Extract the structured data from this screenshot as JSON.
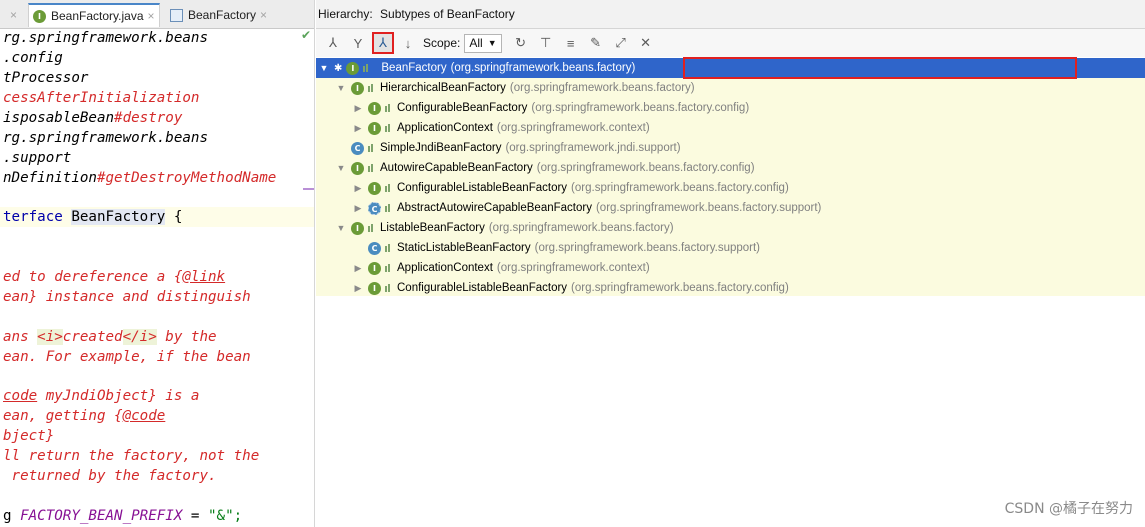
{
  "editor": {
    "tabs": [
      {
        "label": "BeanFactory.java",
        "close": "×"
      },
      {
        "label": "BeanFactory",
        "close": "×"
      }
    ],
    "left_close": "×",
    "lines": [
      "rg.springframework.beans",
      ".config",
      "tProcessor",
      "cessAfterInitialization",
      "isposableBean",
      "#destroy",
      "rg.springframework.beans",
      ".support",
      "nDefinition",
      "#getDestroyMethodName",
      "terface ",
      "BeanFactory",
      " {",
      "ed to dereference a {",
      "@link",
      "ean} instance and distinguish",
      "ans ",
      "<i>",
      "created",
      "</i>",
      " by the",
      "ean. For example, if the bean",
      "code",
      " myJndiObject} is a",
      "ean, getting {",
      "@code",
      "bject}",
      "ll return the factory, not the",
      " returned by the factory.",
      "g ",
      "FACTORY_BEAN_PREFIX",
      " = ",
      "\"&\";"
    ]
  },
  "hierarchy": {
    "title": "Hierarchy:",
    "subtitle": "Subtypes of BeanFactory",
    "toolbar": {
      "scope_label": "Scope:",
      "scope_value": "All"
    },
    "nodes": [
      {
        "name": "BeanFactory",
        "pkg": "(org.springframework.beans.factory)"
      },
      {
        "name": "HierarchicalBeanFactory",
        "pkg": "(org.springframework.beans.factory)"
      },
      {
        "name": "ConfigurableBeanFactory",
        "pkg": "(org.springframework.beans.factory.config)"
      },
      {
        "name": "ApplicationContext",
        "pkg": "(org.springframework.context)"
      },
      {
        "name": "SimpleJndiBeanFactory",
        "pkg": "(org.springframework.jndi.support)"
      },
      {
        "name": "AutowireCapableBeanFactory",
        "pkg": "(org.springframework.beans.factory.config)"
      },
      {
        "name": "ConfigurableListableBeanFactory",
        "pkg": "(org.springframework.beans.factory.config)"
      },
      {
        "name": "AbstractAutowireCapableBeanFactory",
        "pkg": "(org.springframework.beans.factory.support)"
      },
      {
        "name": "ListableBeanFactory",
        "pkg": "(org.springframework.beans.factory)"
      },
      {
        "name": "StaticListableBeanFactory",
        "pkg": "(org.springframework.beans.factory.support)"
      },
      {
        "name": "ApplicationContext",
        "pkg": "(org.springframework.context)"
      },
      {
        "name": "ConfigurableListableBeanFactory",
        "pkg": "(org.springframework.beans.factory.config)"
      }
    ]
  },
  "watermark": "CSDN @橘子在努力",
  "colors": {
    "selection": "#2f65ca",
    "tree_background": "#fbfbdf",
    "highlight_box": "#e02020"
  }
}
